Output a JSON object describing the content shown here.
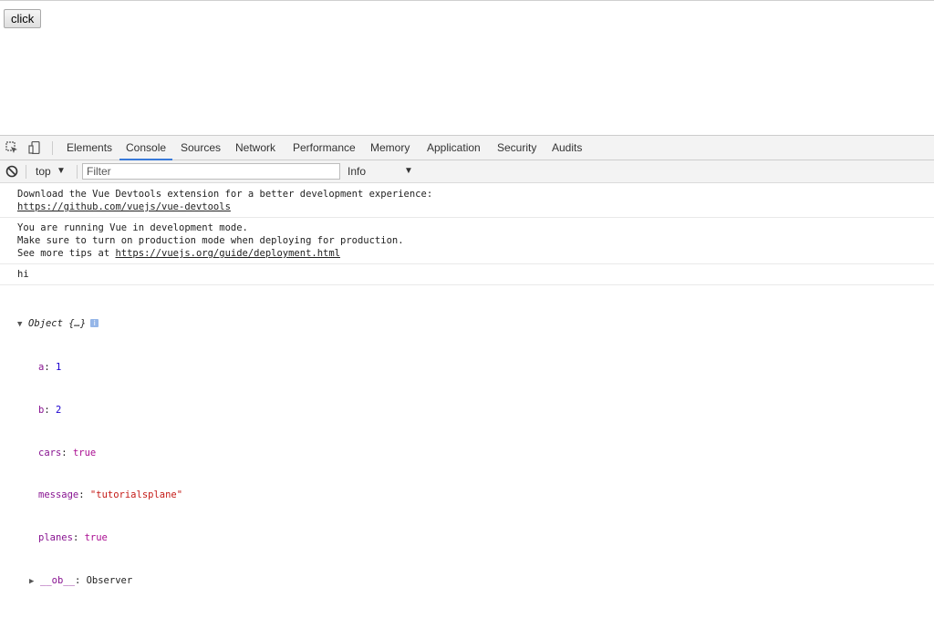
{
  "page": {
    "button_label": "click"
  },
  "devtools": {
    "tabs": [
      "Elements",
      "Console",
      "Sources",
      "Network",
      "Performance",
      "Memory",
      "Application",
      "Security",
      "Audits"
    ],
    "active_tab": "Console",
    "toolbar": {
      "context": "top",
      "filter_placeholder": "Filter",
      "level": "Info"
    },
    "console": {
      "msg1_line1": "Download the Vue Devtools extension for a better development experience:",
      "msg1_link": "https://github.com/vuejs/vue-devtools",
      "msg2_line1": "You are running Vue in development mode.",
      "msg2_line2": "Make sure to turn on production mode when deploying for production.",
      "msg2_line3_prefix": "See more tips at ",
      "msg2_link": "https://vuejs.org/guide/deployment.html",
      "msg3": "hi",
      "object": {
        "title": "Object {…}",
        "badge": "i",
        "props": [
          {
            "key": "a",
            "value": "1",
            "type": "num"
          },
          {
            "key": "b",
            "value": "2",
            "type": "num"
          },
          {
            "key": "cars",
            "value": "true",
            "type": "bool"
          },
          {
            "key": "message",
            "value": "\"tutorialsplane\"",
            "type": "str"
          },
          {
            "key": "planes",
            "value": "true",
            "type": "bool"
          }
        ],
        "proto_key": "__ob__",
        "proto_value": "Observer"
      }
    }
  }
}
